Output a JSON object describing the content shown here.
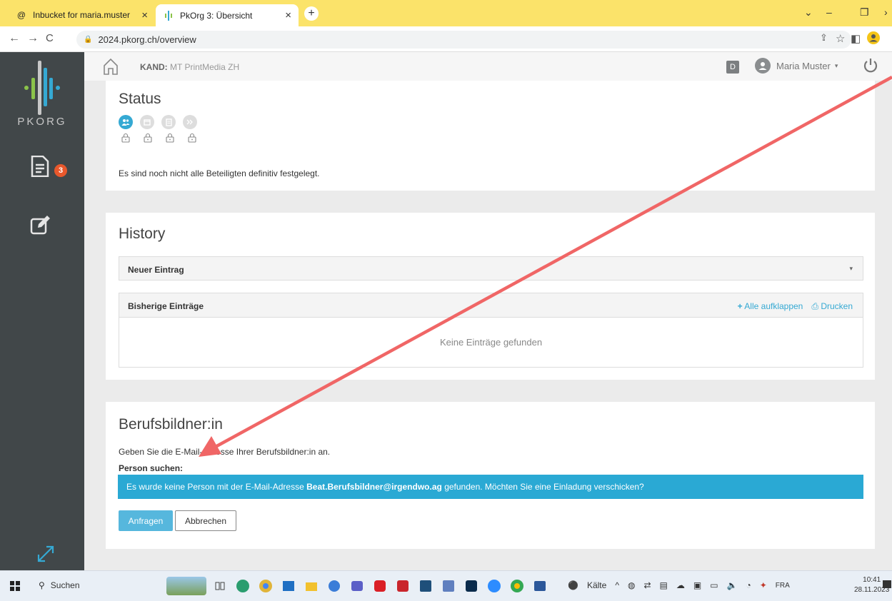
{
  "browser": {
    "tabs": [
      {
        "label": "Inbucket for maria.muster",
        "icon": "at-icon"
      },
      {
        "label": "PkOrg 3: Übersicht",
        "icon": "pkorg-icon"
      }
    ],
    "url": "2024.pkorg.ch/overview"
  },
  "sidebar": {
    "logo_text": "PKORG",
    "documents_badge": "3"
  },
  "header": {
    "kand_label": "KAND:",
    "kand_value": "MT PrintMedia ZH",
    "d_badge": "D",
    "user_name": "Maria Muster"
  },
  "status": {
    "title": "Status",
    "message": "Es sind noch nicht alle Beteiligten definitiv festgelegt."
  },
  "history": {
    "title": "History",
    "new_entry": "Neuer Eintrag",
    "previous_entries": "Bisherige Einträge",
    "expand_all": "Alle aufklappen",
    "print": "Drucken",
    "empty": "Keine Einträge gefunden"
  },
  "trainer": {
    "title": "Berufsbildner:in",
    "instruction": "Geben Sie die E-Mail-Adresse Ihrer Berufsbildner:in an.",
    "search_label": "Person suchen:",
    "info_pre": "Es wurde keine Person mit der E-Mail-Adresse",
    "info_email": "Beat.Berufsbildner@irgendwo.ag",
    "info_post": "gefunden. Möchten Sie eine Einladung verschicken?",
    "request_button": "Anfragen",
    "cancel_button": "Abbrechen"
  },
  "taskbar": {
    "search": "Suchen",
    "weather": "Kälte",
    "lang": "FRA",
    "time": "10:41",
    "date": "28.11.2023"
  },
  "colors": {
    "accent": "#2aa9d4",
    "sidebar": "#414749",
    "badge": "#e8582c",
    "annotation_arrow": "#f06666"
  }
}
